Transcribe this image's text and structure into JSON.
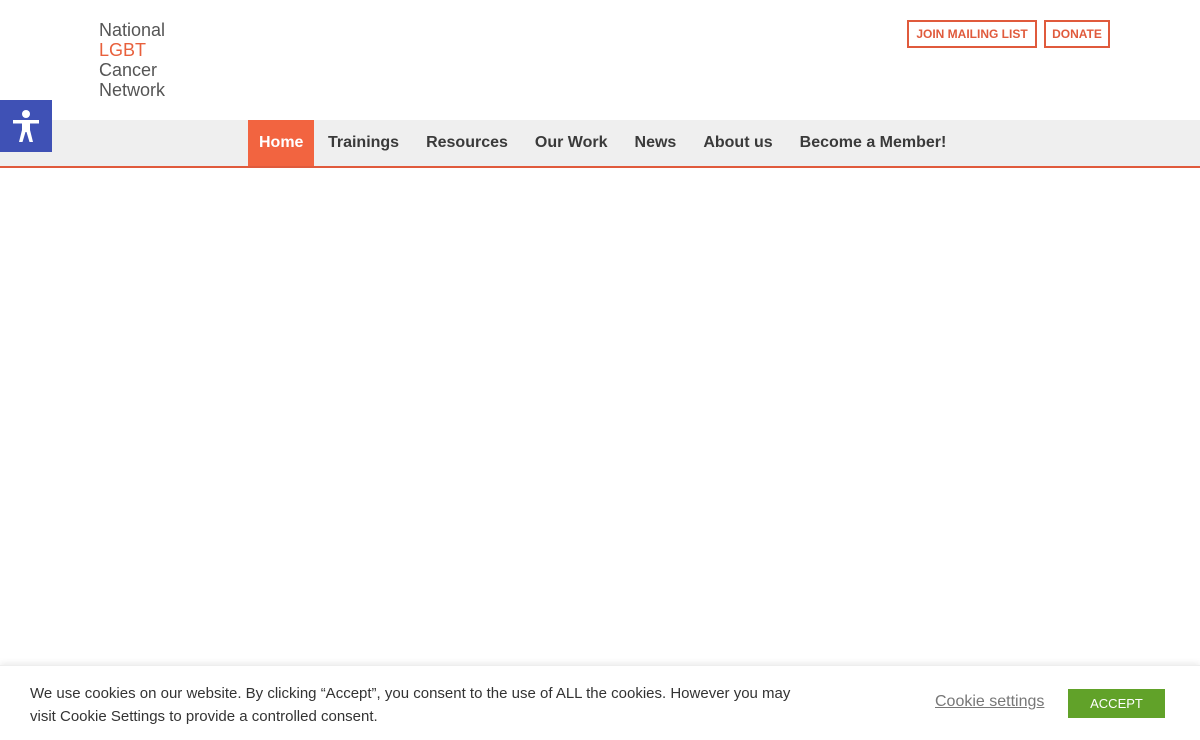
{
  "logo": {
    "line1": "National",
    "line2": "LGBT",
    "line3": "Cancer",
    "line4": "Network"
  },
  "header": {
    "mailing_label": "JOIN MAILING LIST",
    "donate_label": "DONATE"
  },
  "accessibility": {
    "icon": "accessibility-person-icon"
  },
  "nav": {
    "items": [
      {
        "label": "Home"
      },
      {
        "label": "Trainings"
      },
      {
        "label": "Resources"
      },
      {
        "label": "Our Work"
      },
      {
        "label": "News"
      },
      {
        "label": "About us"
      },
      {
        "label": "Become a Member!"
      }
    ],
    "active_index": 0
  },
  "cookie": {
    "message": "We use cookies on our website. By clicking “Accept”, you consent to the use of ALL the cookies. However you may visit Cookie Settings to provide a controlled consent.",
    "settings_label": "Cookie settings",
    "accept_label": "ACCEPT"
  },
  "colors": {
    "accent": "#e05a3c",
    "nav_active": "#f26440",
    "accessibility_blue": "#3f51b5",
    "accept_green": "#61a229",
    "nav_bg": "#efefef"
  }
}
